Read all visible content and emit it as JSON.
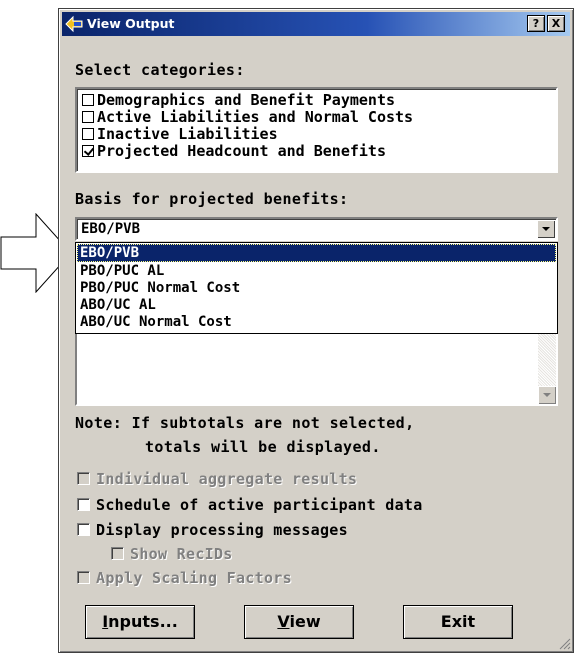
{
  "window": {
    "title": "View Output",
    "help_label": "?",
    "close_label": "X"
  },
  "categories": {
    "label": "Select categories:",
    "items": [
      {
        "label": "Demographics and Benefit Payments",
        "checked": false
      },
      {
        "label": "Active Liabilities and Normal Costs",
        "checked": false
      },
      {
        "label": "Inactive Liabilities",
        "checked": false
      },
      {
        "label": "Projected Headcount and Benefits",
        "checked": true
      }
    ]
  },
  "basis": {
    "label": "Basis for projected benefits:",
    "selected": "EBO/PVB",
    "options": [
      "EBO/PVB",
      "PBO/PUC AL",
      "PBO/PUC Normal Cost",
      "ABO/UC AL",
      "ABO/UC Normal Cost"
    ]
  },
  "note": {
    "line1": "Note: If subtotals are not selected,",
    "line2": "totals will be displayed."
  },
  "options": {
    "individual": {
      "label": "Individual aggregate results",
      "checked": false,
      "enabled": false
    },
    "schedule": {
      "label": "Schedule of active participant data",
      "checked": false,
      "enabled": true
    },
    "processing": {
      "label": "Display processing messages",
      "checked": false,
      "enabled": true
    },
    "recids": {
      "label": "Show RecIDs",
      "checked": false,
      "enabled": false
    },
    "scaling": {
      "label": "Apply Scaling Factors",
      "checked": false,
      "enabled": false
    }
  },
  "buttons": {
    "inputs": {
      "accel": "I",
      "rest": "nputs..."
    },
    "view": {
      "accel": "V",
      "rest": "iew"
    },
    "exit": {
      "label": "Exit"
    }
  },
  "colors": {
    "titlebar": "#0a246a",
    "selection": "#0a246a",
    "face": "#d4d0c8"
  },
  "icons": [
    "arrow-pointer-icon",
    "app-icon",
    "dropdown-arrow-icon",
    "resize-grip-icon"
  ]
}
